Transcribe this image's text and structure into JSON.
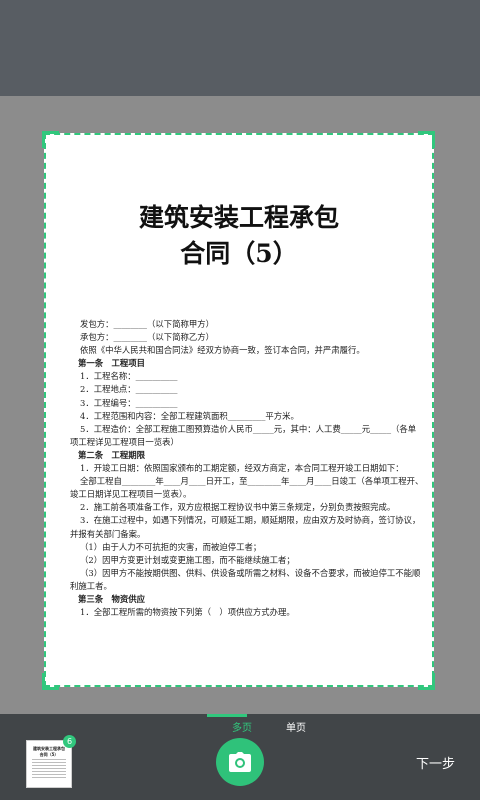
{
  "document": {
    "title_line1": "建筑安装工程承包",
    "title_line2": "合同（5）",
    "lines": [
      "发包方：________（以下简称甲方）",
      "承包方：________（以下简称乙方）",
      "依照《中华人民共和国合同法》经双方协商一致，签订本合同，并严肃履行。",
      "第一条　工程项目",
      "1．工程名称：__________",
      "2．工程地点：__________",
      "3．工程编号：__________",
      "4．工程范围和内容：全部工程建筑面积_________平方米。",
      "5．工程造价：全部工程施工图预算造价人民币_____元，其中：人工费_____元_____（各单项工程详见工程项目一览表）",
      "第二条　工程期限",
      "1．开竣工日期：依照国家颁布的工期定额，经双方商定，本合同工程开竣工日期如下：",
      "全部工程自________年____月____日开工，至________年____月____日竣工（各单项工程开、竣工日期详见工程项目一览表）。",
      "2．施工前各项准备工作，双方应根据工程协议书中第三条规定，分别负责按照完成。",
      "3．在施工过程中，如遇下列情况，可顺延工期，顺延期限，应由双方及时协商，签订协议，并报有关部门备案。",
      "（1）由于人力不可抗拒的灾害，而被迫停工者；",
      "（2）因甲方变更计划或变更施工图，而不能继续施工者；",
      "（3）因甲方不能按期供图、供料、供设备或所需之材料、设备不合要求，而被迫停工不能顺利施工者。",
      "第三条　物资供应",
      "1．全部工程所需的物资按下列第（　）项供应方式办理。"
    ]
  },
  "tabs": {
    "multi": "多页",
    "single": "单页"
  },
  "thumbnail": {
    "badge_count": "6",
    "title_line1": "建筑安装工程承包",
    "title_line2": "合同（5）"
  },
  "actions": {
    "next": "下一步"
  },
  "icons": {
    "shutter": "camera-icon"
  },
  "colors": {
    "accent": "#31c77d",
    "topbar": "#585d63",
    "bottombar": "#414548"
  }
}
